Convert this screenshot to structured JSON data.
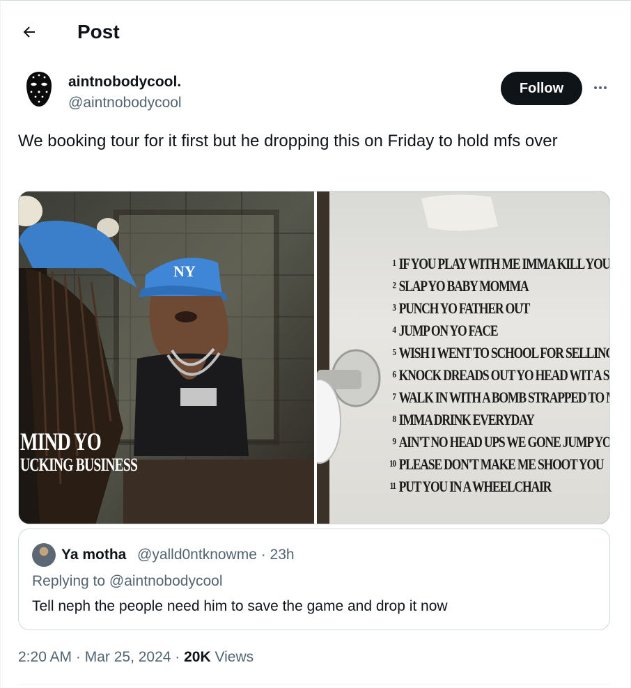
{
  "header": {
    "back_icon": "arrow-left-icon",
    "title": "Post"
  },
  "author": {
    "display_name": "aintnobodycool.",
    "handle": "@aintnobodycool",
    "avatar_icon": "hockey-mask-icon",
    "follow_label": "Follow",
    "more_icon": "more-horizontal-icon"
  },
  "tweet": {
    "text": "We booking tour for it first but he dropping this on Friday to hold mfs over"
  },
  "media": {
    "cover_line1": "MIND YO",
    "cover_line2": "UCKING BUSINESS",
    "tracks": [
      {
        "num": "1",
        "title": "IF YOU PLAY WITH ME IMMA KILL YOU"
      },
      {
        "num": "2",
        "title": "SLAP YO BABY MOMMA"
      },
      {
        "num": "3",
        "title": "PUNCH YO FATHER OUT"
      },
      {
        "num": "4",
        "title": "JUMP ON YO FACE"
      },
      {
        "num": "5",
        "title": "WISH I WENT TO SCHOOL FOR SELLING CR"
      },
      {
        "num": "6",
        "title": "KNOCK DREADS OUT YO HEAD WIT A SWIT"
      },
      {
        "num": "7",
        "title": "WALK IN WITH A BOMB STRAPPED TO MY"
      },
      {
        "num": "8",
        "title": "IMMA DRINK EVERYDAY"
      },
      {
        "num": "9",
        "title": "AIN'T NO HEAD UPS WE GONE JUMP YOU"
      },
      {
        "num": "10",
        "title": "PLEASE DON'T MAKE ME SHOOT YOU"
      },
      {
        "num": "11",
        "title": "PUT YOU IN A WHEELCHAIR"
      }
    ]
  },
  "quote": {
    "display_name": "Ya motha",
    "meta": "@yalld0ntknowme · 23h",
    "replying_to": "Replying to @aintnobodycool",
    "text": "Tell neph the people need him to save the game and drop it now"
  },
  "footer": {
    "time_date": "2:20 AM · Mar 25, 2024 · ",
    "views_count": "20K",
    "views_label": " Views"
  },
  "colors": {
    "primary_text": "#0f1419",
    "secondary_text": "#536471",
    "border": "#cfd9de",
    "cap_blue": "#3f86d6"
  }
}
